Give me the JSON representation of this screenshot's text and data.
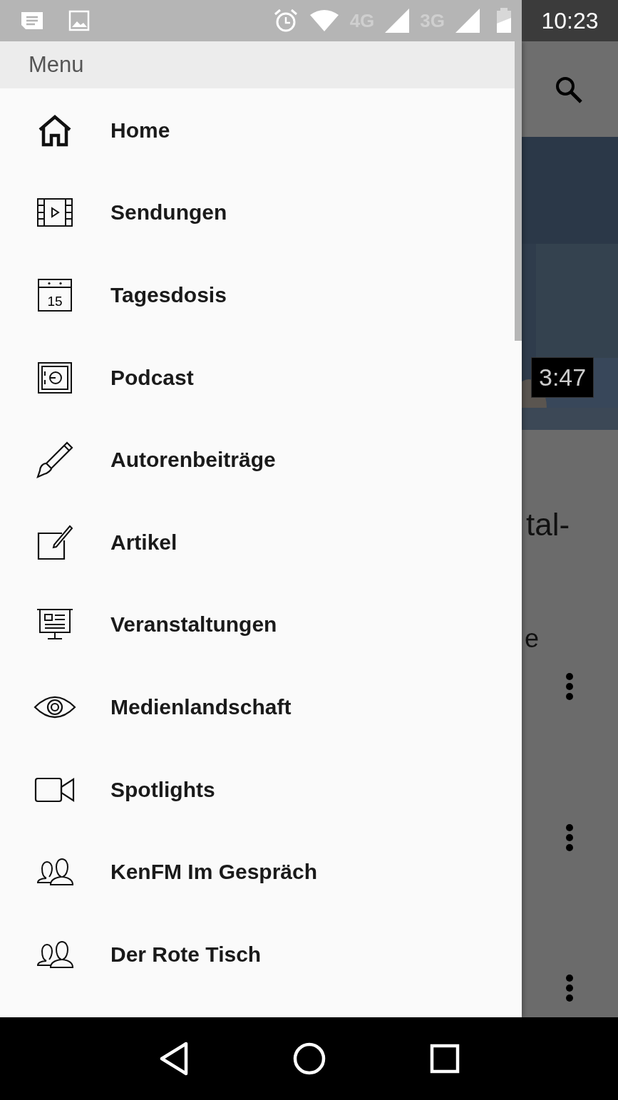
{
  "status_bar": {
    "network_labels": [
      "4G",
      "3G"
    ],
    "time": "10:23"
  },
  "drawer": {
    "title": "Menu",
    "items": [
      {
        "label": "Home"
      },
      {
        "label": "Sendungen"
      },
      {
        "label": "Tagesdosis",
        "icon_text": "15"
      },
      {
        "label": "Podcast"
      },
      {
        "label": "Autorenbeiträge"
      },
      {
        "label": "Artikel"
      },
      {
        "label": "Veranstaltungen"
      },
      {
        "label": "Medienlandschaft"
      },
      {
        "label": "Spotlights"
      },
      {
        "label": "KenFM Im Gespräch"
      },
      {
        "label": "Der Rote Tisch"
      }
    ]
  },
  "background": {
    "duration": "3:47",
    "title_fragment": "tal-",
    "text_fragment": "e"
  }
}
